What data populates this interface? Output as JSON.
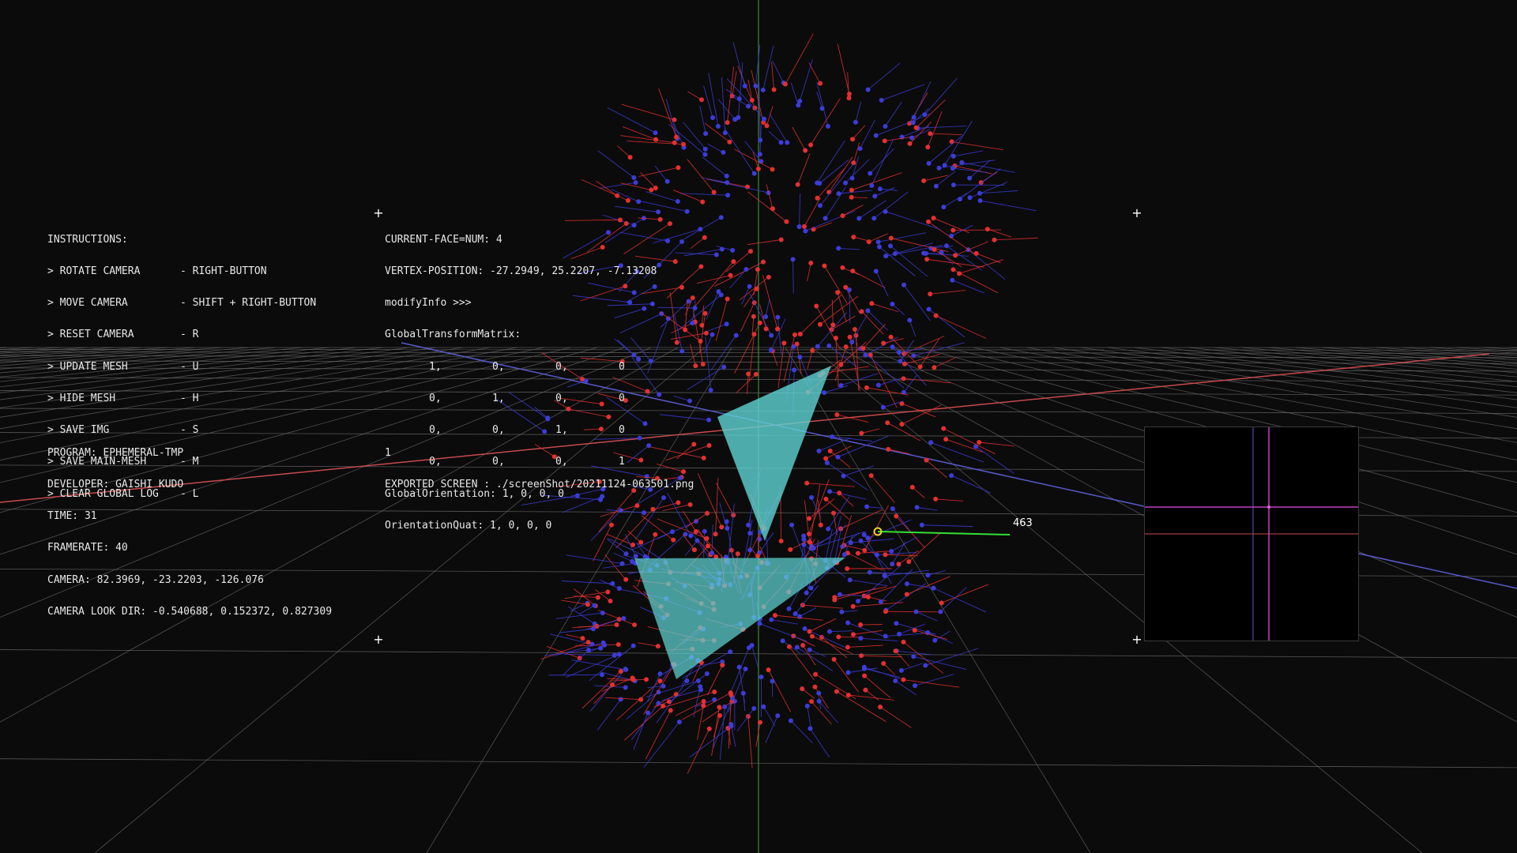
{
  "instructions": {
    "title": "INSTRUCTIONS:",
    "items": [
      {
        "action": "> ROTATE CAMERA",
        "key": "- RIGHT-BUTTON"
      },
      {
        "action": "> MOVE CAMERA",
        "key": "- SHIFT + RIGHT-BUTTON"
      },
      {
        "action": "> RESET CAMERA",
        "key": "- R"
      },
      {
        "action": "> UPDATE MESH",
        "key": "- U"
      },
      {
        "action": "> HIDE MESH",
        "key": "- H"
      },
      {
        "action": "> SAVE IMG",
        "key": "- S"
      },
      {
        "action": "> SAVE MAIN-MESH",
        "key": "- M"
      },
      {
        "action": "> CLEAR GLOBAL LOG",
        "key": "- L"
      }
    ]
  },
  "face_info": {
    "current_face": "CURRENT-FACE=NUM: 4",
    "vertex_position": "VERTEX-POSITION: -27.2949, 25.2207, -7.13208",
    "modify_info": "modifyInfo >>>",
    "matrix_label": "GlobalTransformMatrix:",
    "matrix": [
      [
        "1,",
        "0,",
        "0,",
        "0"
      ],
      [
        "0,",
        "1,",
        "0,",
        "0"
      ],
      [
        "0,",
        "0,",
        "1,",
        "0"
      ],
      [
        "0,",
        "0,",
        "0,",
        "1"
      ]
    ],
    "orientation": "GlobalOrientation: 1, 0, 0, 0",
    "quat": "OrientationQuat: 1, 0, 0, 0"
  },
  "program_info": {
    "program": "PROGRAM: EPHEMERAL-TMP",
    "developer": "DEVELOPER: GAISHI KUDO",
    "time": "TIME: 31",
    "framerate": "FRAMERATE: 40",
    "camera": "CAMERA: 82.3969, -23.2203, -126.076",
    "look_dir": "CAMERA LOOK DIR: -0.540688, 0.152372, 0.827309"
  },
  "log": {
    "line_number": "1",
    "message": "EXPORTED SCREEN : ./screenShot/20211124-063501.png"
  },
  "viewport": {
    "vertex_count_label": "463",
    "colors": {
      "background": "#0b0b0b",
      "grid": "#6e6e6e",
      "axis_x": "#c84a4a",
      "axis_z": "#5a5acc",
      "axis_y": "#3a8a3a",
      "normal_red": "#e43030",
      "normal_blue": "#3c3cd8",
      "faces": "#5fd3d3",
      "highlight": "#34e034",
      "selected_vertex": "#f0d020",
      "minimap_axis": "#c040c0"
    }
  }
}
